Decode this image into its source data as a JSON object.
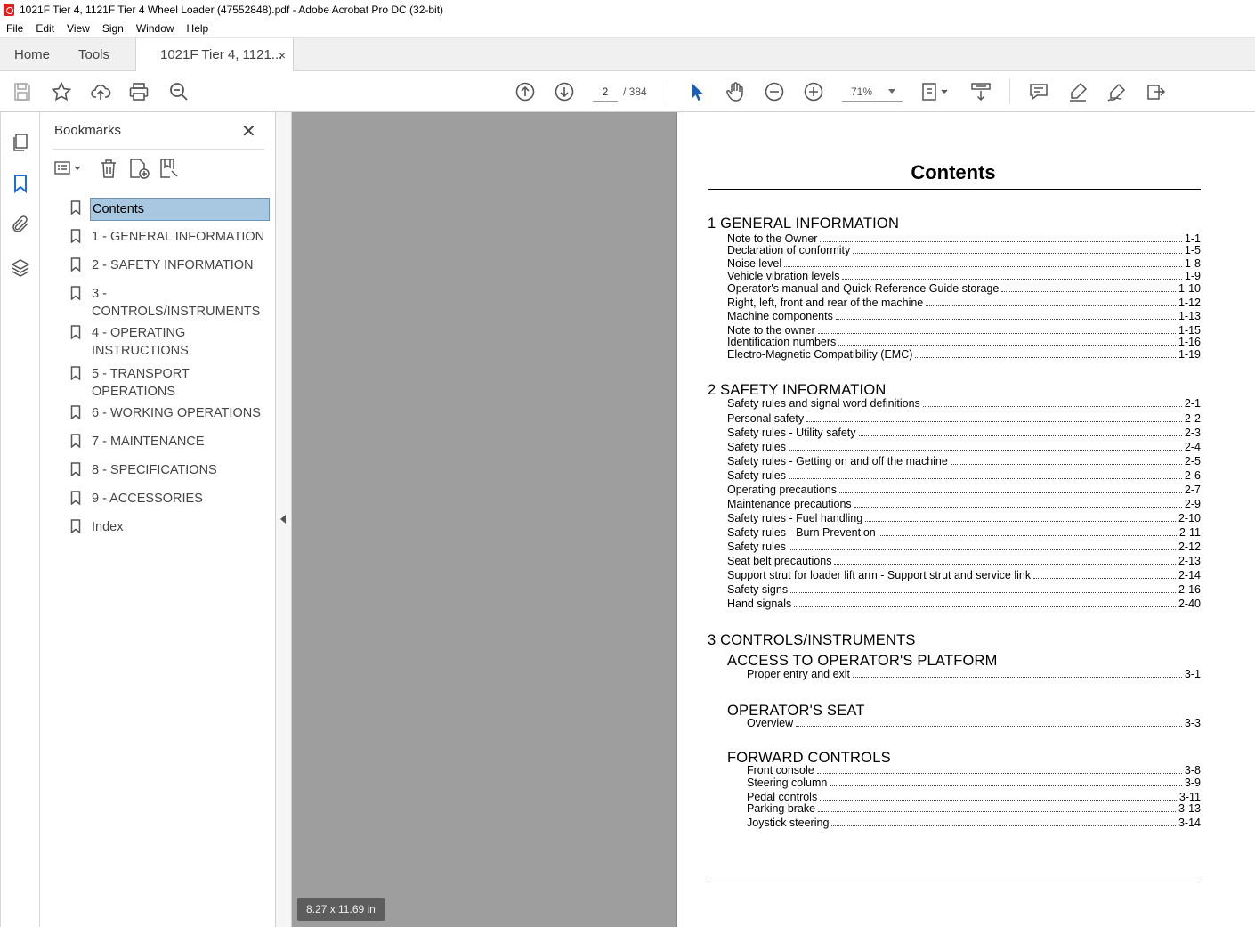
{
  "window": {
    "title": "1021F Tier 4, 1121F Tier 4 Wheel Loader (47552848).pdf - Adobe Acrobat Pro DC (32-bit)"
  },
  "menu": [
    "File",
    "Edit",
    "View",
    "Sign",
    "Window",
    "Help"
  ],
  "tabs": {
    "home": "Home",
    "tools": "Tools",
    "document": "1021F Tier 4, 1121...",
    "close": "×"
  },
  "toolbar": {
    "page_current": "2",
    "page_total": "/ 384",
    "zoom": "71%"
  },
  "bookmarks": {
    "title": "Bookmarks",
    "close": "✕",
    "items": [
      "Contents",
      "1 - GENERAL INFORMATION",
      "2 - SAFETY INFORMATION",
      "3 - CONTROLS/INSTRUMENTS",
      "4 - OPERATING INSTRUCTIONS",
      "5 - TRANSPORT OPERATIONS",
      "6 - WORKING OPERATIONS",
      "7 - MAINTENANCE",
      "8 - SPECIFICATIONS",
      "9 - ACCESSORIES",
      "Index"
    ],
    "selected_index": 0
  },
  "page_size": "8.27 x 11.69 in",
  "document": {
    "title": "Contents",
    "sections": [
      {
        "heading": "1 GENERAL INFORMATION",
        "entries": [
          {
            "label": "Note to the Owner",
            "page": "1-1"
          },
          {
            "label": "Declaration of conformity",
            "page": "1-5"
          },
          {
            "label": "Noise level",
            "page": "1-8"
          },
          {
            "label": "Vehicle vibration levels",
            "page": "1-9"
          },
          {
            "label": "Operator's manual and Quick Reference Guide storage",
            "page": "1-10"
          },
          {
            "label": "Right, left, front and rear of the machine",
            "page": "1-12"
          },
          {
            "label": "Machine components",
            "page": "1-13"
          },
          {
            "label": "Note to the owner",
            "page": "1-15"
          },
          {
            "label": "Identification numbers",
            "page": "1-16"
          },
          {
            "label": "Electro-Magnetic Compatibility (EMC)",
            "page": "1-19"
          }
        ]
      },
      {
        "heading": "2 SAFETY INFORMATION",
        "entries": [
          {
            "label": "Safety rules and signal word definitions",
            "page": "2-1"
          },
          {
            "label": "Personal safety",
            "page": "2-2"
          },
          {
            "label": "Safety rules - Utility safety",
            "page": "2-3"
          },
          {
            "label": "Safety rules",
            "page": "2-4"
          },
          {
            "label": "Safety rules - Getting on and off the machine",
            "page": "2-5"
          },
          {
            "label": "Safety rules",
            "page": "2-6"
          },
          {
            "label": "Operating precautions",
            "page": "2-7"
          },
          {
            "label": "Maintenance precautions",
            "page": "2-9"
          },
          {
            "label": "Safety rules - Fuel handling",
            "page": "2-10"
          },
          {
            "label": "Safety rules - Burn Prevention",
            "page": "2-11"
          },
          {
            "label": "Safety rules",
            "page": "2-12"
          },
          {
            "label": "Seat belt precautions",
            "page": "2-13"
          },
          {
            "label": "Support strut for loader lift arm - Support strut and service link",
            "page": "2-14"
          },
          {
            "label": "Safety signs",
            "page": "2-16"
          },
          {
            "label": "Hand signals",
            "page": "2-40"
          }
        ]
      },
      {
        "heading": "3 CONTROLS/INSTRUMENTS",
        "subsections": [
          {
            "heading": "ACCESS TO OPERATOR'S PLATFORM",
            "entries": [
              {
                "label": "Proper entry and exit",
                "page": "3-1"
              }
            ]
          },
          {
            "heading": "OPERATOR'S SEAT",
            "entries": [
              {
                "label": "Overview",
                "page": "3-3"
              }
            ]
          },
          {
            "heading": "FORWARD CONTROLS",
            "entries": [
              {
                "label": "Front console",
                "page": "3-8"
              },
              {
                "label": "Steering column",
                "page": "3-9"
              },
              {
                "label": "Pedal controls",
                "page": "3-11"
              },
              {
                "label": "Parking brake",
                "page": "3-13"
              },
              {
                "label": "Joystick steering",
                "page": "3-14"
              }
            ]
          }
        ]
      }
    ]
  }
}
